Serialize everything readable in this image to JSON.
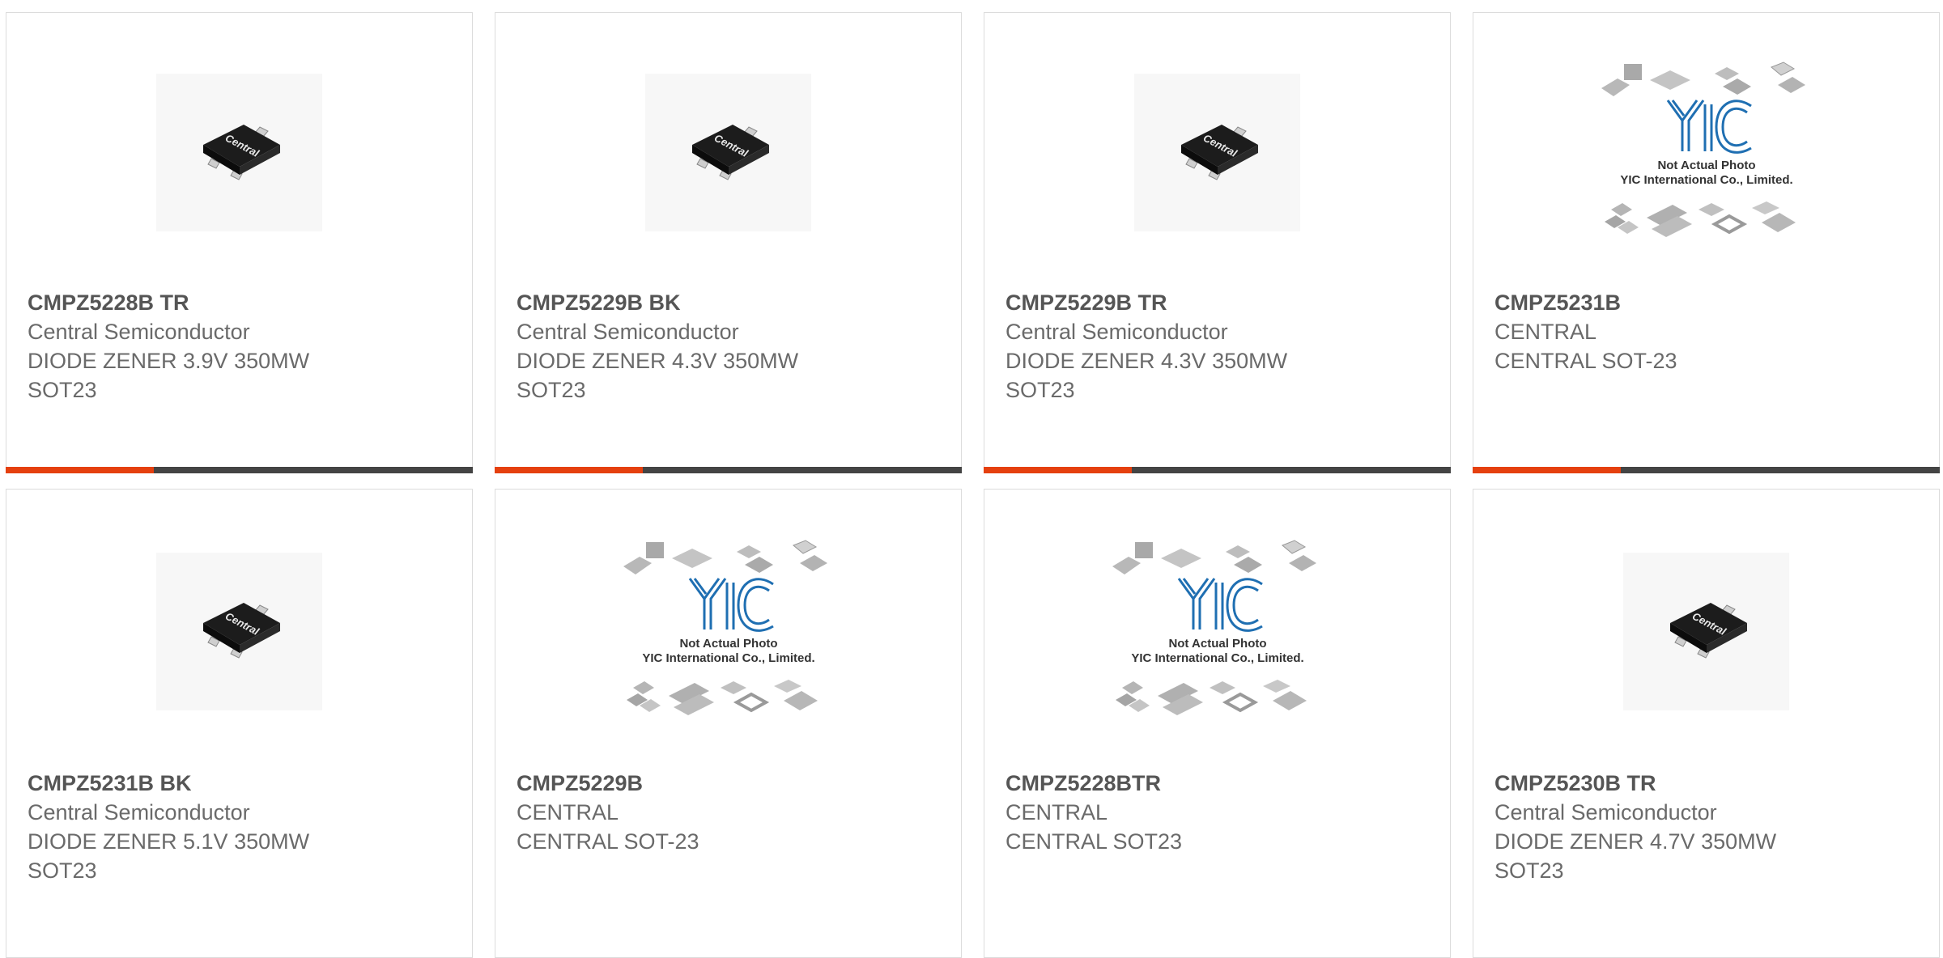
{
  "products": [
    {
      "part": "CMPZ5228B TR",
      "lines": [
        "Central Semiconductor",
        "DIODE ZENER 3.9V 350MW",
        "SOT23"
      ],
      "image": "central-sot23-chip",
      "chip_text": "Central"
    },
    {
      "part": "CMPZ5229B BK",
      "lines": [
        "Central Semiconductor",
        "DIODE ZENER 4.3V 350MW",
        "SOT23"
      ],
      "image": "central-sot23-chip",
      "chip_text": "Central"
    },
    {
      "part": "CMPZ5229B TR",
      "lines": [
        "Central Semiconductor",
        "DIODE ZENER 4.3V 350MW",
        "SOT23"
      ],
      "image": "central-sot23-chip",
      "chip_text": "Central"
    },
    {
      "part": "CMPZ5231B",
      "lines": [
        "CENTRAL",
        "CENTRAL SOT-23"
      ],
      "image": "yic-placeholder",
      "placeholder_line1": "Not Actual Photo",
      "placeholder_line2": "YIC International Co., Limited."
    },
    {
      "part": "CMPZ5231B BK",
      "lines": [
        "Central Semiconductor",
        "DIODE ZENER 5.1V 350MW",
        "SOT23"
      ],
      "image": "central-sot23-chip",
      "chip_text": "Central"
    },
    {
      "part": "CMPZ5229B",
      "lines": [
        "CENTRAL",
        "CENTRAL SOT-23"
      ],
      "image": "yic-placeholder",
      "placeholder_line1": "Not Actual Photo",
      "placeholder_line2": "YIC International Co., Limited."
    },
    {
      "part": "CMPZ5228BTR",
      "lines": [
        "CENTRAL",
        "CENTRAL SOT23"
      ],
      "image": "yic-placeholder",
      "placeholder_line1": "Not Actual Photo",
      "placeholder_line2": "YIC International Co., Limited."
    },
    {
      "part": "CMPZ5230B TR",
      "lines": [
        "Central Semiconductor",
        "DIODE ZENER 4.7V 350MW",
        "SOT23"
      ],
      "image": "central-sot23-chip",
      "chip_text": "Central"
    }
  ],
  "colors": {
    "accent": "#e5400f",
    "bar_dark": "#444444",
    "text_bold": "#555555",
    "text": "#6a6a6a",
    "yic_blue": "#1f6fb2"
  }
}
